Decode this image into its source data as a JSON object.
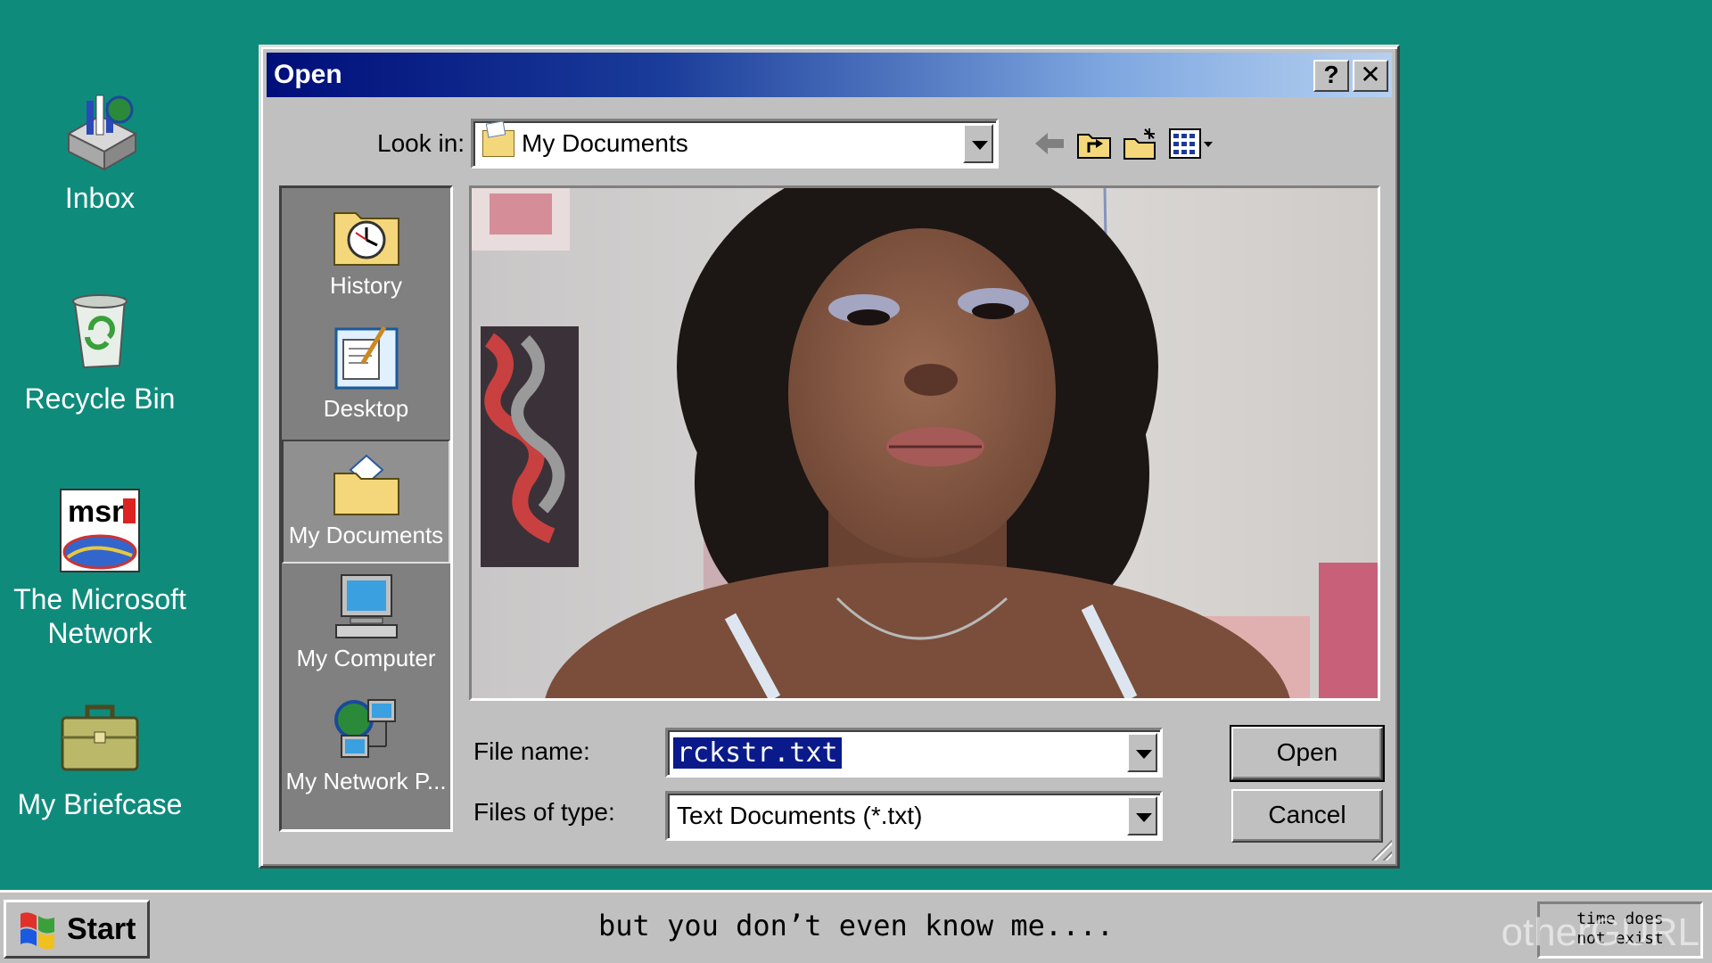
{
  "desktop": {
    "icons": [
      {
        "label": "Inbox",
        "icon": "inbox-icon"
      },
      {
        "label": "Recycle Bin",
        "icon": "recycle-bin-icon"
      },
      {
        "label": "The Microsoft Network",
        "icon": "msn-icon"
      },
      {
        "label": "My Briefcase",
        "icon": "briefcase-icon"
      }
    ]
  },
  "dialog": {
    "title": "Open",
    "help_label": "?",
    "close_label": "✕",
    "look_in_label": "Look in:",
    "look_in_value": "My Documents",
    "places": [
      {
        "label": "History",
        "icon": "history-icon"
      },
      {
        "label": "Desktop",
        "icon": "desktop-icon"
      },
      {
        "label": "My Documents",
        "icon": "my-documents-icon",
        "selected": true
      },
      {
        "label": "My Computer",
        "icon": "my-computer-icon"
      },
      {
        "label": "My Network P...",
        "icon": "network-places-icon"
      }
    ],
    "file_name_label": "File name:",
    "file_name_value": "rckstr.txt",
    "files_of_type_label": "Files of type:",
    "files_of_type_value": "Text Documents (*.txt)",
    "open_label": "Open",
    "cancel_label": "Cancel"
  },
  "taskbar": {
    "start_label": "Start",
    "subtitle": "but you don’t even know me....",
    "tray_line1": "time does",
    "tray_line2": "not exist",
    "watermark": "otherGURL"
  },
  "colors": {
    "desktop": "#0f8b7c",
    "title_gradient_start": "#000e7a",
    "title_gradient_end": "#b6d0f0",
    "selection": "#0a1a8a"
  }
}
